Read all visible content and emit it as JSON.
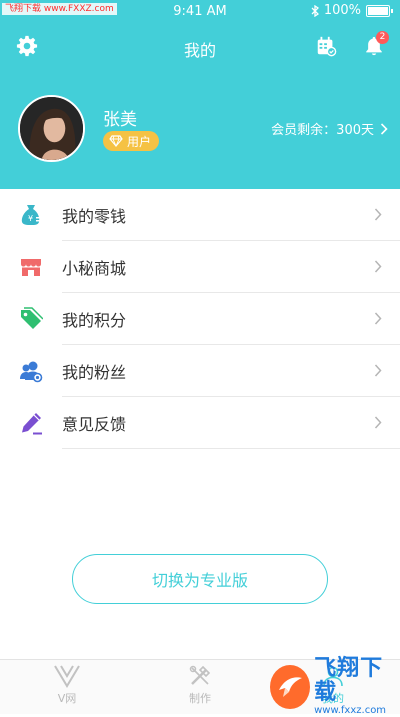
{
  "watermark": "飞翔下载 www.FXXZ.com",
  "status_bar": {
    "time": "9:41 AM",
    "battery": "100%"
  },
  "navbar": {
    "title": "我的",
    "notification_count": "2"
  },
  "profile": {
    "name": "张美",
    "role": "用户",
    "membership": "会员剩余：300天"
  },
  "menu": [
    {
      "label": "我的零钱",
      "icon": "money-bag-icon",
      "color": "#3ab7c9"
    },
    {
      "label": "小秘商城",
      "icon": "store-icon",
      "color": "#f06a6a"
    },
    {
      "label": "我的积分",
      "icon": "tag-icon",
      "color": "#2fbf71"
    },
    {
      "label": "我的粉丝",
      "icon": "fans-icon",
      "color": "#3b7bd6"
    },
    {
      "label": "意见反馈",
      "icon": "pencil-icon",
      "color": "#7a4fd1"
    }
  ],
  "switch_button": "切换为专业版",
  "tabs": [
    {
      "label": "V网",
      "icon": "v-logo-icon"
    },
    {
      "label": "制作",
      "icon": "tools-icon"
    },
    {
      "label": "我的",
      "icon": "profile-icon"
    }
  ],
  "overlay": {
    "main": "飞翔下载",
    "url": "www.fxxz.com"
  },
  "colors": {
    "primary": "#43cfd8",
    "badge": "#ff5a5a",
    "role_badge": "#f5c244"
  }
}
